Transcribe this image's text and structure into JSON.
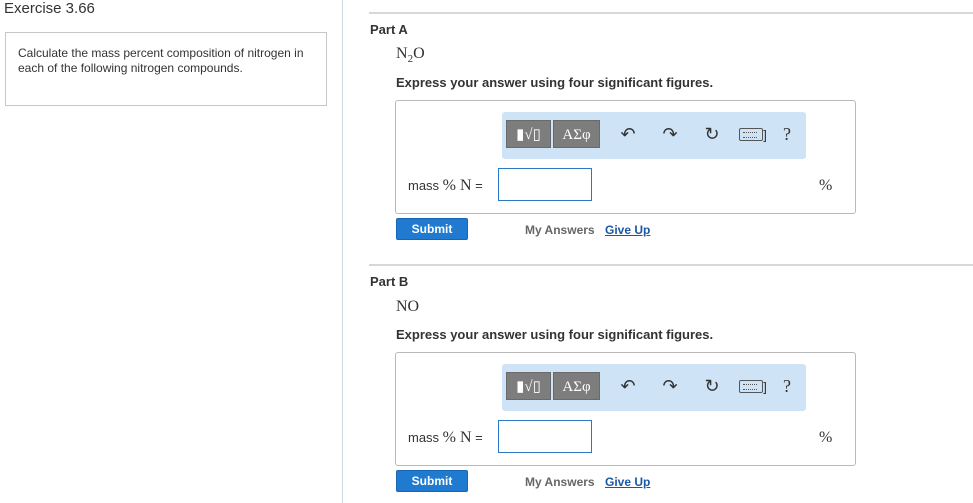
{
  "exercise": {
    "title": "Exercise 3.66",
    "problem_text": "Calculate the mass percent composition of nitrogen in each of the following nitrogen compounds."
  },
  "parts": [
    {
      "label": "Part A",
      "formula_main": "N",
      "formula_sub": "2",
      "formula_tail": "O",
      "instruction": "Express your answer using four significant figures.",
      "answer_label_prefix": "mass ",
      "answer_label_pct": "% N",
      "answer_label_suffix": " =",
      "answer_value": "",
      "unit": "%",
      "submit_label": "Submit",
      "my_answers_label": "My Answers",
      "give_up_label": "Give Up"
    },
    {
      "label": "Part B",
      "formula_main": "NO",
      "formula_sub": "",
      "formula_tail": "",
      "instruction": "Express your answer using four significant figures.",
      "answer_label_prefix": "mass ",
      "answer_label_pct": "% N",
      "answer_label_suffix": " =",
      "answer_value": "",
      "unit": "%",
      "submit_label": "Submit",
      "my_answers_label": "My Answers",
      "give_up_label": "Give Up"
    }
  ],
  "toolbar": {
    "templates_label": "▮√▯",
    "greek_label": "ΑΣφ",
    "undo_icon": "undo-icon",
    "redo_icon": "redo-icon",
    "reset_icon": "reset-icon",
    "keyboard_icon": "keyboard-icon",
    "help_label": "?"
  },
  "colors": {
    "toolbar_bg": "#cfe3f7",
    "submit_bg": "#1f7ad0",
    "link": "#1c57a5"
  }
}
